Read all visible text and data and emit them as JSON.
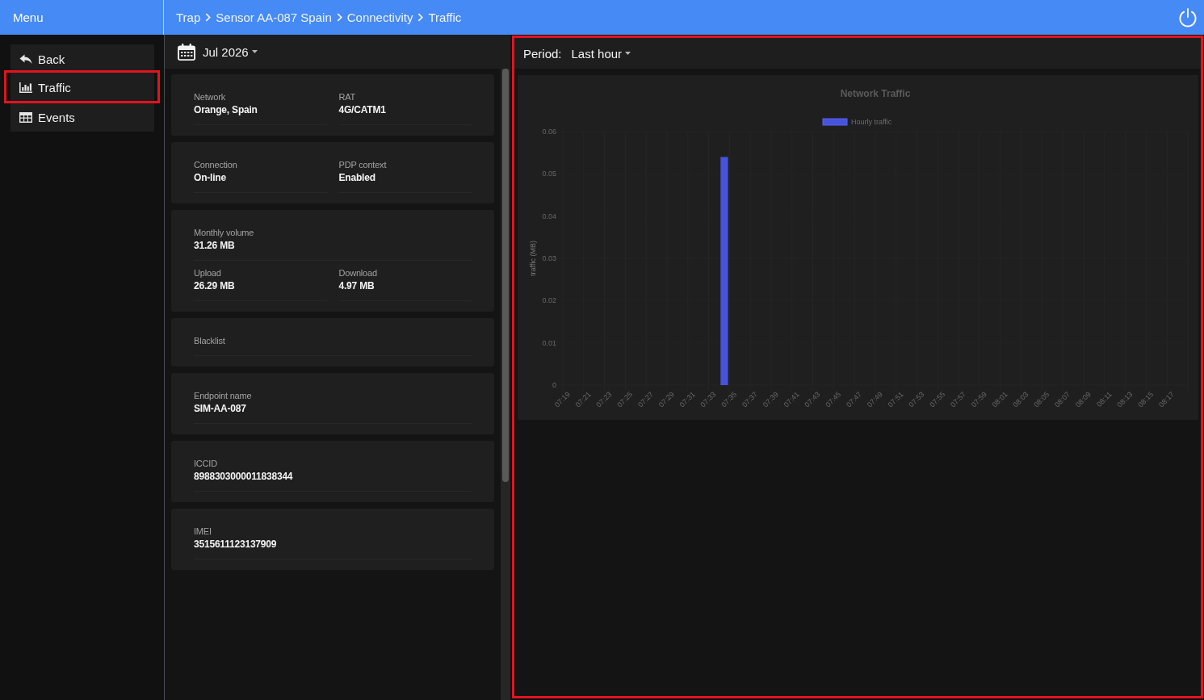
{
  "top_bar": {
    "menu_title": "Menu",
    "breadcrumb": [
      "Trap",
      "Sensor AA-087 Spain",
      "Connectivity",
      "Traffic"
    ]
  },
  "sidebar": {
    "items": [
      {
        "label": "Back",
        "kind": "back",
        "selected": false
      },
      {
        "label": "Traffic",
        "kind": "chart",
        "selected": true
      },
      {
        "label": "Events",
        "kind": "table",
        "selected": false
      }
    ]
  },
  "details": {
    "month": "Jul 2026",
    "cards": [
      {
        "rows": [
          [
            {
              "label": "Network",
              "value": "Orange, Spain"
            },
            {
              "label": "RAT",
              "value": "4G/CATM1"
            }
          ]
        ]
      },
      {
        "rows": [
          [
            {
              "label": "Connection",
              "value": "On-line"
            },
            {
              "label": "PDP context",
              "value": "Enabled"
            }
          ]
        ]
      },
      {
        "rows": [
          [
            {
              "label": "Monthly volume",
              "value": "31.26 MB"
            }
          ],
          [
            {
              "label": "Upload",
              "value": "26.29 MB"
            },
            {
              "label": "Download",
              "value": "4.97 MB"
            }
          ]
        ]
      },
      {
        "rows": [
          [
            {
              "label": "Blacklist"
            }
          ]
        ]
      },
      {
        "rows": [
          [
            {
              "label": "Endpoint name",
              "value": "SIM-AA-087"
            }
          ]
        ]
      },
      {
        "rows": [
          [
            {
              "label": "ICCID",
              "value": "8988303000011838344"
            }
          ]
        ]
      },
      {
        "rows": [
          [
            {
              "label": "IMEI",
              "value": "3515611123137909"
            }
          ]
        ]
      }
    ]
  },
  "traffic_panel": {
    "outlined": true,
    "period_label": "Period:",
    "period_value": "Last hour",
    "chart_data": {
      "type": "bar",
      "title": "Network Traffic",
      "ylabel": "traffic (MB)",
      "categories": [
        "07:19",
        null,
        "07:21",
        null,
        "07:23",
        null,
        "07:25",
        null,
        "07:27",
        null,
        "07:29",
        null,
        "07:31",
        null,
        "07:33",
        null,
        "07:35",
        null,
        "07:37",
        null,
        "07:39",
        null,
        "07:41",
        null,
        "07:43",
        null,
        "07:45",
        null,
        "07:47",
        null,
        "07:49",
        null,
        "07:51",
        null,
        "07:53",
        null,
        "07:55",
        null,
        "07:57",
        null,
        "07:59",
        null,
        "08:01",
        null,
        "08:03",
        null,
        "08:05",
        null,
        "08:07",
        null,
        "08:09",
        null,
        "08:11",
        null,
        "08:13",
        null,
        "08:15",
        null,
        "08:17",
        null
      ],
      "series": [
        {
          "name": "Hourly traffic",
          "color": "#4752de",
          "values": [
            0,
            0,
            0,
            0,
            0,
            0,
            0,
            0,
            0,
            0,
            0,
            0,
            0,
            0,
            0,
            0.054,
            0,
            0,
            0,
            0,
            0,
            0,
            0,
            0,
            0,
            0,
            0,
            0,
            0,
            0,
            0,
            0,
            0,
            0,
            0,
            0,
            0,
            0,
            0,
            0,
            0,
            0,
            0,
            0,
            0,
            0,
            0,
            0,
            0,
            0,
            0,
            0,
            0,
            0,
            0,
            0,
            0,
            0,
            0,
            0
          ]
        }
      ],
      "ylim": [
        0,
        0.06
      ],
      "yticks": [
        0,
        0.01,
        0.02,
        0.03,
        0.04,
        0.05,
        0.06
      ]
    }
  }
}
